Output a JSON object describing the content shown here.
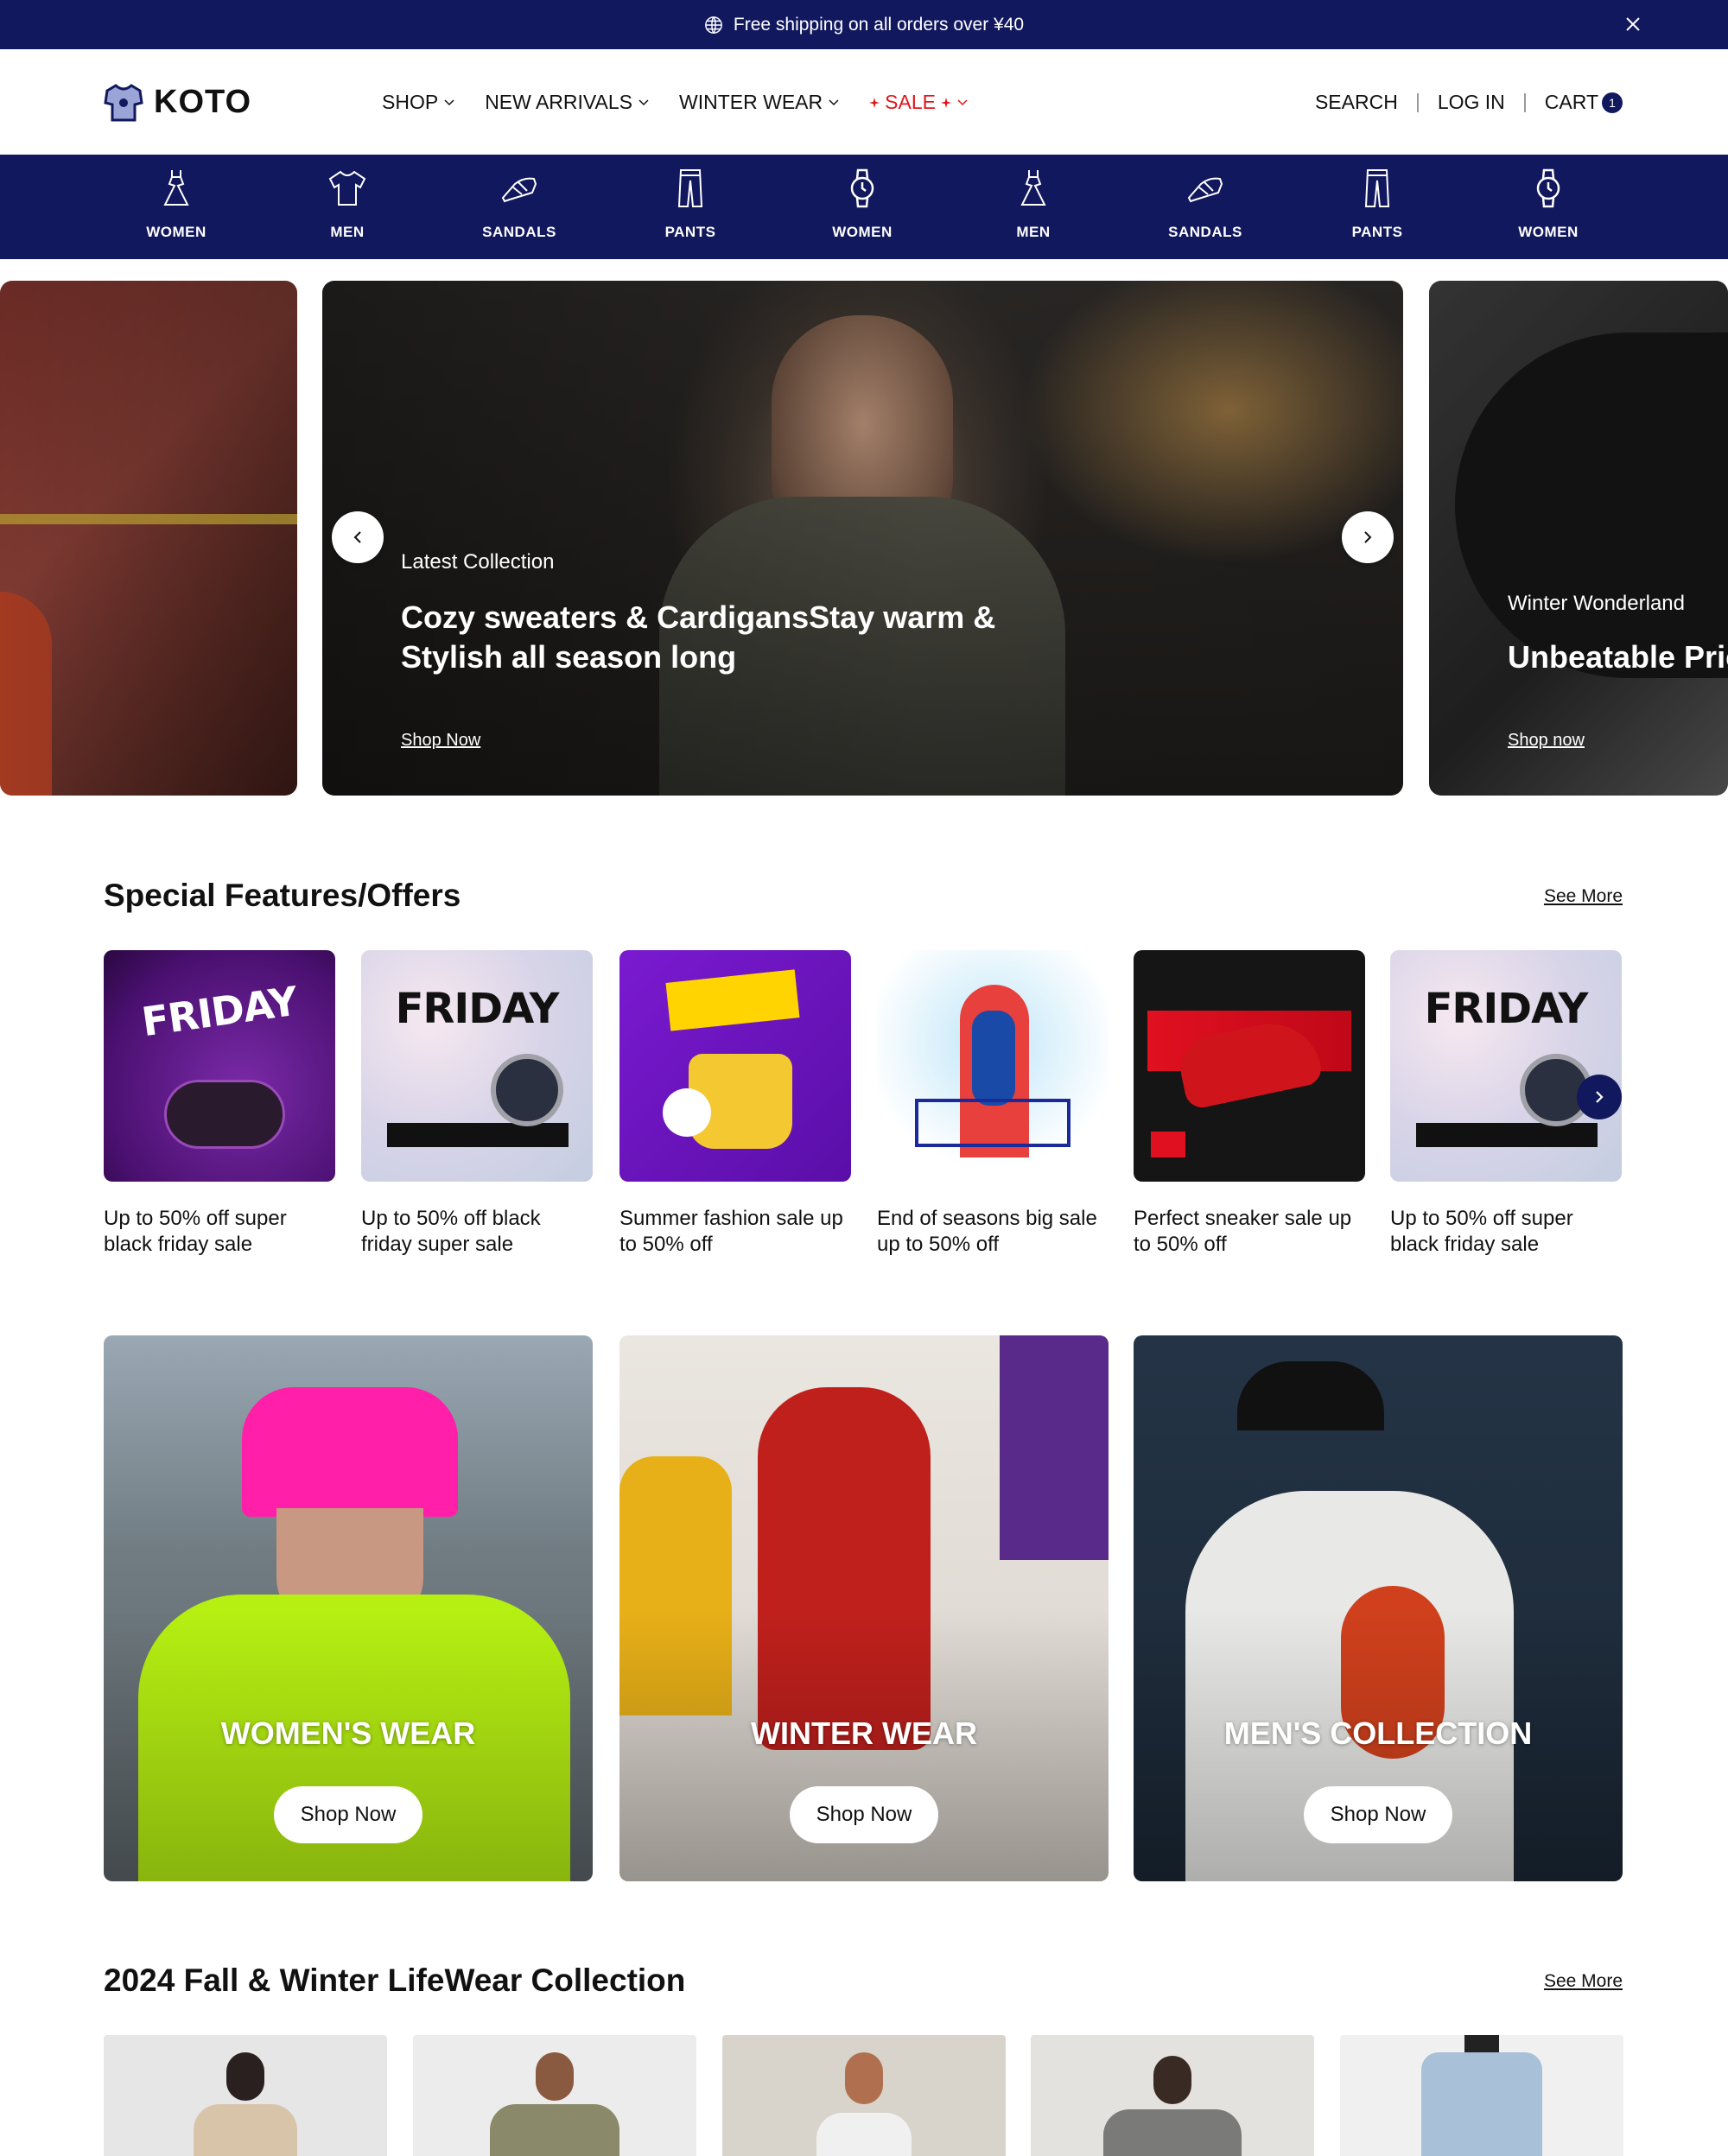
{
  "announcement": {
    "text": "Free shipping on all orders over ¥40"
  },
  "header": {
    "brand": "KOTO",
    "nav": [
      {
        "label": "SHOP"
      },
      {
        "label": "NEW ARRIVALS"
      },
      {
        "label": "WINTER WEAR"
      },
      {
        "label": "SALE"
      }
    ],
    "search": "SEARCH",
    "login": "LOG IN",
    "cart": "CART",
    "cart_count": "1"
  },
  "categories": [
    {
      "label": "WOMEN",
      "icon": "dress-icon"
    },
    {
      "label": "MEN",
      "icon": "tshirt-icon"
    },
    {
      "label": "SANDALS",
      "icon": "sandal-icon"
    },
    {
      "label": "PANTS",
      "icon": "pants-icon"
    },
    {
      "label": "WOMEN",
      "icon": "watch-icon"
    },
    {
      "label": "MEN",
      "icon": "dress-icon"
    },
    {
      "label": "SANDALS",
      "icon": "sandal-icon"
    },
    {
      "label": "PANTS",
      "icon": "pants-icon"
    },
    {
      "label": "WOMEN",
      "icon": "watch-icon"
    }
  ],
  "hero": {
    "main": {
      "eyebrow": "Latest Collection",
      "title_line1": "Cozy sweaters & CardigansStay warm &",
      "title_line2": "Stylish all season long",
      "cta": "Shop Now"
    },
    "right": {
      "eyebrow": "Winter Wonderland",
      "title": "Unbeatable Prices",
      "cta": "Shop now"
    }
  },
  "offers": {
    "title": "Special Features/Offers",
    "see_more": "See More",
    "items": [
      {
        "line1": "Up to 50% off super",
        "line2": "black friday sale"
      },
      {
        "line1": "Up to 50% off black",
        "line2": "friday super sale"
      },
      {
        "line1": "Summer fashion sale up",
        "line2": "to 50% off"
      },
      {
        "line1": "End of seasons big sale",
        "line2": "up to 50% off"
      },
      {
        "line1": "Perfect sneaker sale up",
        "line2": "to 50% off"
      },
      {
        "line1": "Up to 50% off super",
        "line2": "black friday sale"
      }
    ]
  },
  "collections": [
    {
      "title": "WOMEN'S WEAR",
      "cta": "Shop Now"
    },
    {
      "title": "WINTER WEAR",
      "cta": "Shop Now"
    },
    {
      "title": "MEN'S COLLECTION",
      "cta": "Shop Now"
    }
  ],
  "lifewear": {
    "title": "2024 Fall & Winter LifeWear Collection",
    "see_more": "See More"
  },
  "colors": {
    "navy": "#12185e",
    "sale_red": "#e0161a"
  }
}
